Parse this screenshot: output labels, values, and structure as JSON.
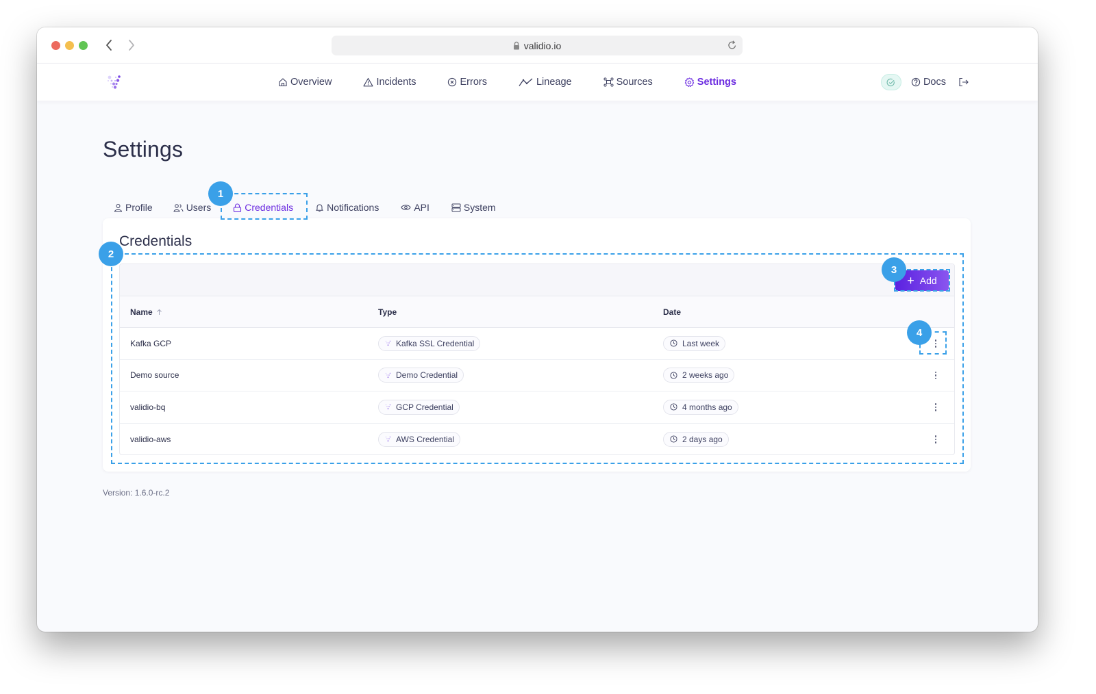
{
  "browser": {
    "url": "validio.io"
  },
  "nav": {
    "items": [
      {
        "label": "Overview",
        "icon": "home-icon",
        "active": false
      },
      {
        "label": "Incidents",
        "icon": "warning-icon",
        "active": false
      },
      {
        "label": "Errors",
        "icon": "error-circle-icon",
        "active": false
      },
      {
        "label": "Lineage",
        "icon": "lineage-icon",
        "active": false
      },
      {
        "label": "Sources",
        "icon": "sources-icon",
        "active": false
      },
      {
        "label": "Settings",
        "icon": "gear-icon",
        "active": true
      }
    ],
    "docs_label": "Docs",
    "accent": "#6b2be0"
  },
  "page": {
    "title": "Settings"
  },
  "tabs": [
    {
      "label": "Profile",
      "icon": "user-icon"
    },
    {
      "label": "Users",
      "icon": "users-icon"
    },
    {
      "label": "Credentials",
      "icon": "lock-icon",
      "active": true
    },
    {
      "label": "Notifications",
      "icon": "bell-icon"
    },
    {
      "label": "API",
      "icon": "eye-icon"
    },
    {
      "label": "System",
      "icon": "server-icon"
    }
  ],
  "credentials": {
    "title": "Credentials",
    "add_label": "Add",
    "columns": {
      "name": "Name",
      "type": "Type",
      "date": "Date"
    },
    "rows": [
      {
        "name": "Kafka GCP",
        "type": "Kafka SSL Credential",
        "date": "Last week"
      },
      {
        "name": "Demo source",
        "type": "Demo Credential",
        "date": "2 weeks ago"
      },
      {
        "name": "validio-bq",
        "type": "GCP Credential",
        "date": "4 months ago"
      },
      {
        "name": "validio-aws",
        "type": "AWS Credential",
        "date": "2 days ago"
      }
    ]
  },
  "footer": {
    "version": "Version: 1.6.0-rc.2"
  },
  "annotations": [
    "1",
    "2",
    "3",
    "4"
  ]
}
